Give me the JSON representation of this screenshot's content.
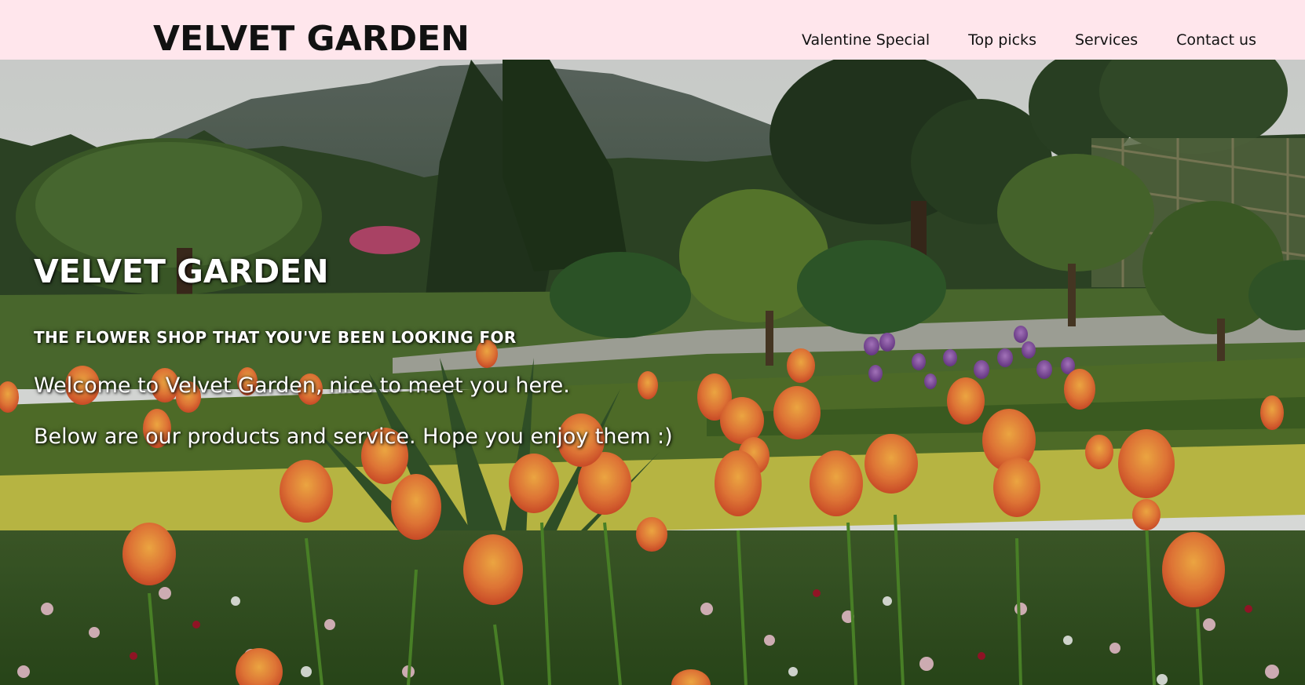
{
  "navbar": {
    "brand": "VELVET GARDEN",
    "links": [
      {
        "label": "Valentine Special"
      },
      {
        "label": "Top picks"
      },
      {
        "label": "Services"
      },
      {
        "label": "Contact us"
      }
    ]
  },
  "hero": {
    "title": "VELVET GARDEN",
    "subtitle": "THE FLOWER SHOP THAT YOU'VE BEEN LOOKING FOR",
    "line1": "Welcome to Velvet Garden, nice to meet you here.",
    "line2": "Below are our products and service. Hope you enjoy them :)"
  },
  "colors": {
    "navbar_bg": "#ffe6ec",
    "text_dark": "#111111",
    "hero_text": "#ffffff"
  }
}
